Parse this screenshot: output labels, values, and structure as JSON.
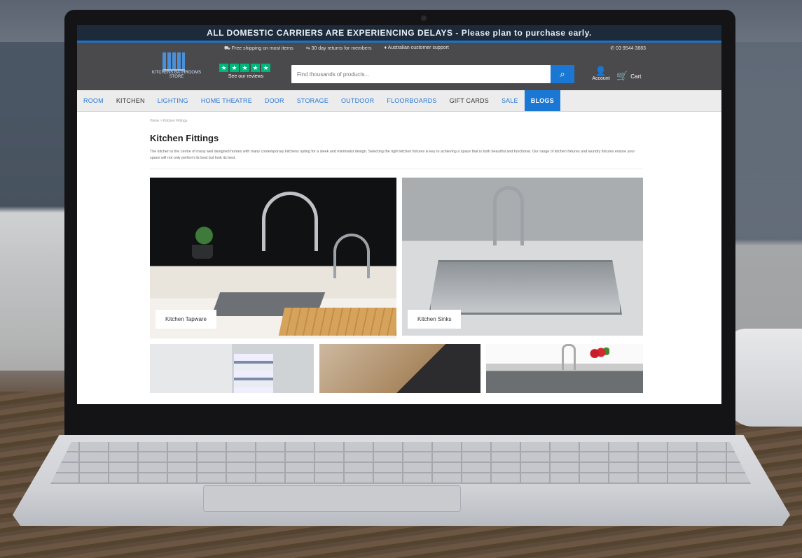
{
  "banner": {
    "text": "ALL DOMESTIC CARRIERS ARE EXPERIENCING DELAYS - Please plan to purchase early."
  },
  "header": {
    "perks": [
      "Free shipping on most items",
      "30 day returns for members",
      "Australian customer support"
    ],
    "phone": "03 9544 3883",
    "logo_text": "KITCHENS BATHROOMS STORE",
    "rating": {
      "stars": [
        "★",
        "★",
        "★",
        "★",
        "★"
      ],
      "label": "See our reviews"
    },
    "search": {
      "placeholder": "Find thousands of products...",
      "button_icon": "search-icon"
    },
    "account_label": "Account",
    "cart_label": "Cart"
  },
  "nav": {
    "items": [
      "ROOM",
      "KITCHEN",
      "LIGHTING",
      "HOME THEATRE",
      "DOOR",
      "STORAGE",
      "OUTDOOR",
      "FLOORBOARDS",
      "GIFT CARDS",
      "SALE",
      "BLOGS"
    ]
  },
  "breadcrumb": {
    "home": "Home",
    "separator": ">",
    "current": "Kitchen Fittings"
  },
  "page": {
    "title": "Kitchen Fittings",
    "description": "The kitchen is the centre of many well designed homes with many contemporary kitchens opting for a sleek and minimalist design. Selecting the right kitchen fixtures is key to achieving a space that is both beautiful and functional. Our range of kitchen fixtures and laundry fixtures ensure your space will not only perform its best but look its best."
  },
  "tiles": [
    {
      "label": "Kitchen Tapware"
    },
    {
      "label": "Kitchen Sinks"
    },
    {
      "label": ""
    },
    {
      "label": ""
    },
    {
      "label": ""
    }
  ],
  "colors": {
    "accent": "#1a78d4",
    "header_bg": "#4a4a4d",
    "trust_green": "#00b67a"
  }
}
